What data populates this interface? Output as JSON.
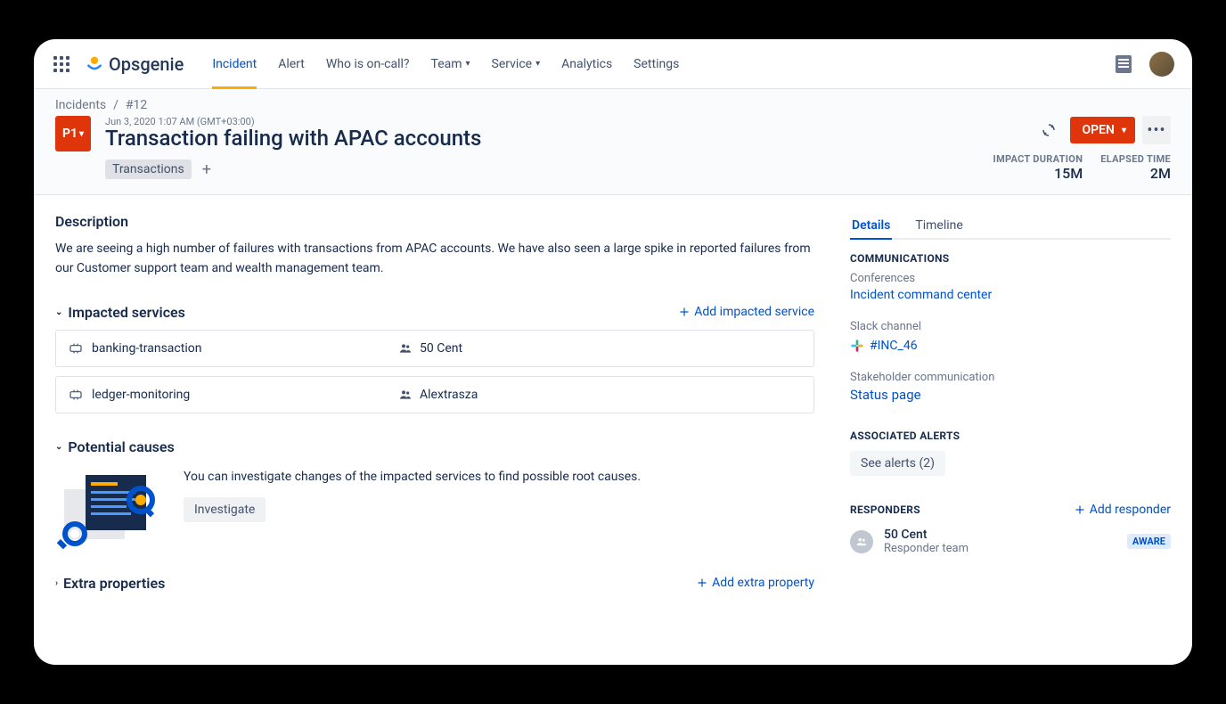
{
  "brand": "Opsgenie",
  "nav": {
    "incident": "Incident",
    "alert": "Alert",
    "who_on_call": "Who is on-call?",
    "team": "Team",
    "service": "Service",
    "analytics": "Analytics",
    "settings": "Settings"
  },
  "breadcrumb": {
    "root": "Incidents",
    "sep": "/",
    "leaf": "#12"
  },
  "header": {
    "priority": "P1",
    "timestamp": "Jun 3, 2020 1:07 AM (GMT+03:00)",
    "title": "Transaction failing with APAC accounts",
    "tag": "Transactions",
    "add_tag": "+",
    "status": "OPEN",
    "impact_duration_label": "IMPACT DURATION",
    "impact_duration": "15M",
    "elapsed_label": "ELAPSED TIME",
    "elapsed": "2M"
  },
  "description": {
    "heading": "Description",
    "body": "We are seeing a high number of failures with transactions from APAC accounts. We have also seen a large spike in reported failures from our Customer support team and wealth management team."
  },
  "impacted": {
    "heading": "Impacted services",
    "add": "Add impacted service",
    "rows": [
      {
        "service": "banking-transaction",
        "team": "50 Cent"
      },
      {
        "service": "ledger-monitoring",
        "team": "Alextrasza"
      }
    ]
  },
  "causes": {
    "heading": "Potential causes",
    "text": "You can investigate changes of the impacted services to find possible root causes.",
    "button": "Investigate"
  },
  "extra": {
    "heading": "Extra properties",
    "add": "Add extra property"
  },
  "sidebar": {
    "tabs": {
      "details": "Details",
      "timeline": "Timeline"
    },
    "communications": {
      "label": "COMMUNICATIONS",
      "conferences": "Conferences",
      "icc_link": "Incident command center",
      "slack_label": "Slack channel",
      "slack_channel": "#INC_46",
      "stakeholder_label": "Stakeholder communication",
      "status_page": "Status page"
    },
    "alerts": {
      "label": "ASSOCIATED ALERTS",
      "button": "See alerts (2)"
    },
    "responders": {
      "label": "RESPONDERS",
      "add": "Add responder",
      "item": {
        "name": "50 Cent",
        "role": "Responder team",
        "badge": "AWARE"
      }
    }
  }
}
